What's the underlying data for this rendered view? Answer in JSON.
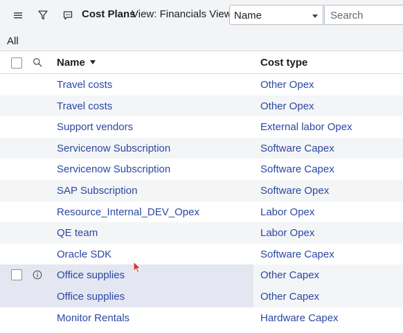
{
  "header": {
    "title": "Cost Plans",
    "view_label": "View: Financials View",
    "filter_select": {
      "selected": "Name"
    },
    "search": {
      "placeholder": "Search"
    },
    "icons": [
      "hamburger-menu-icon",
      "filter-icon",
      "chat-icon"
    ]
  },
  "breadcrumb": {
    "label": "All"
  },
  "table": {
    "columns": [
      {
        "label": "Name",
        "sorted": "descending"
      },
      {
        "label": "Cost type"
      }
    ],
    "rows": [
      {
        "name": "Travel costs",
        "cost_type": "Other Opex"
      },
      {
        "name": "Travel costs",
        "cost_type": "Other Opex"
      },
      {
        "name": "Support vendors",
        "cost_type": "External labor Opex"
      },
      {
        "name": "Servicenow Subscription",
        "cost_type": "Software Capex"
      },
      {
        "name": "Servicenow Subscription",
        "cost_type": "Software Capex"
      },
      {
        "name": "SAP Subscription",
        "cost_type": "Software Opex"
      },
      {
        "name": "Resource_Internal_DEV_Opex",
        "cost_type": "Labor Opex"
      },
      {
        "name": "QE team",
        "cost_type": "Labor Opex"
      },
      {
        "name": "Oracle SDK",
        "cost_type": "Software Capex"
      },
      {
        "name": "Office supplies",
        "cost_type": "Other Capex"
      },
      {
        "name": "Office supplies",
        "cost_type": "Other Capex"
      },
      {
        "name": "Monitor Rentals",
        "cost_type": "Hardware Capex"
      }
    ]
  },
  "colors": {
    "link": "#2b47a3",
    "header_bg": "#f3f4f6",
    "row_alt_bg": "#f4f5f7",
    "row_highlight_bg": "#e4e6f1"
  }
}
